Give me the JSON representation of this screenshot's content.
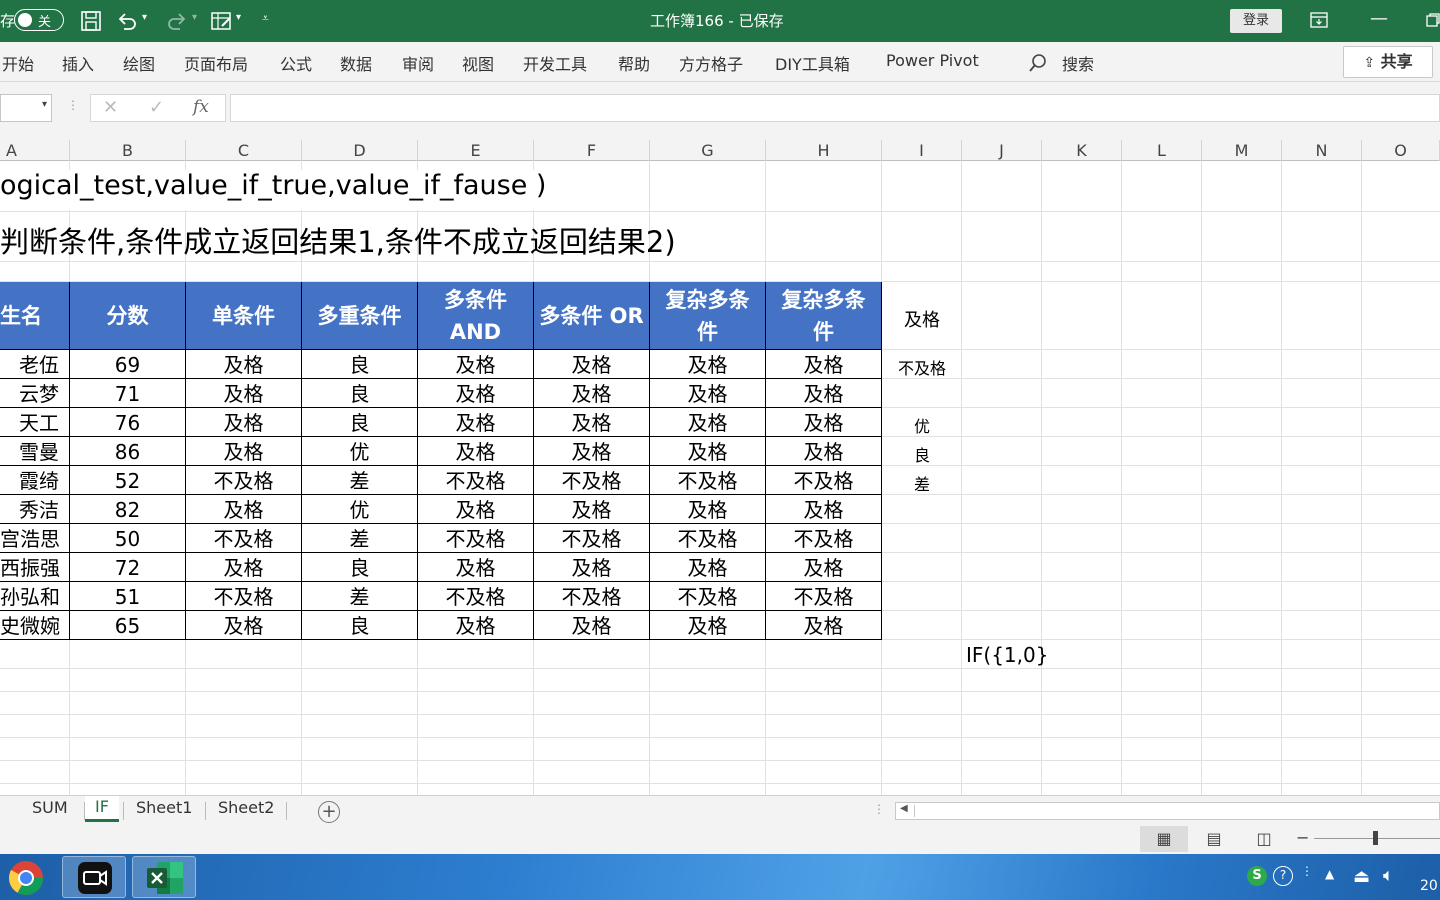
{
  "titlebar": {
    "autosave_prefix": "存",
    "autosave_state": "关",
    "doc_title": "工作簿166 - 已保存",
    "login_label": "登录"
  },
  "ribbon": {
    "tabs": [
      "开始",
      "插入",
      "绘图",
      "页面布局",
      "公式",
      "数据",
      "审阅",
      "视图",
      "开发工具",
      "帮助",
      "方方格子",
      "DIY工具箱",
      "Power Pivot"
    ],
    "search_label": "搜索",
    "share_label": "共享"
  },
  "formula_bar": {
    "name_box": "",
    "formula": "",
    "fx_label": "fx"
  },
  "columns": [
    "A",
    "B",
    "C",
    "D",
    "E",
    "F",
    "G",
    "H",
    "I",
    "J",
    "K",
    "L",
    "M",
    "N",
    "O"
  ],
  "syntax_line1": "ogical_test,value_if_true,value_if_fause )",
  "syntax_line2": "判断条件,条件成立返回结果1,条件不成立返回结果2)",
  "table": {
    "headers": [
      "性名",
      "分数",
      "单条件",
      "多重条件",
      "多条件AND",
      "多条件OR",
      "复杂多条件",
      "复杂多条件"
    ],
    "headers_display": [
      "生名",
      "分数",
      "单条件",
      "多重条件",
      "多条件 AND",
      "多条件 OR",
      "复杂多条 件",
      "复杂多条 件"
    ],
    "rows": [
      [
        "老伍",
        "69",
        "及格",
        "良",
        "及格",
        "及格",
        "及格",
        "及格"
      ],
      [
        "云梦",
        "71",
        "及格",
        "良",
        "及格",
        "及格",
        "及格",
        "及格"
      ],
      [
        "天工",
        "76",
        "及格",
        "良",
        "及格",
        "及格",
        "及格",
        "及格"
      ],
      [
        "雪曼",
        "86",
        "及格",
        "优",
        "及格",
        "及格",
        "及格",
        "及格"
      ],
      [
        "霞绮",
        "52",
        "不及格",
        "差",
        "不及格",
        "不及格",
        "不及格",
        "不及格"
      ],
      [
        "秀洁",
        "82",
        "及格",
        "优",
        "及格",
        "及格",
        "及格",
        "及格"
      ],
      [
        "宫浩思",
        "50",
        "不及格",
        "差",
        "不及格",
        "不及格",
        "不及格",
        "不及格"
      ],
      [
        "西振强",
        "72",
        "及格",
        "良",
        "及格",
        "及格",
        "及格",
        "及格"
      ],
      [
        "孙弘和",
        "51",
        "不及格",
        "差",
        "不及格",
        "不及格",
        "不及格",
        "不及格"
      ],
      [
        "史微婉",
        "65",
        "及格",
        "良",
        "及格",
        "及格",
        "及格",
        "及格"
      ]
    ]
  },
  "side_values": {
    "i_header": "及格",
    "i_row1": "不及格",
    "i_row3": "优",
    "i_row4": "良",
    "i_row5": "差"
  },
  "if_array_text": "IF({1,0}",
  "sheet_tabs": [
    "SUM",
    "IF",
    "Sheet1",
    "Sheet2"
  ],
  "active_sheet": "IF",
  "taskbar": {
    "clock_partial": "20"
  },
  "colors": {
    "excel_green": "#217346",
    "header_blue": "#4472c4"
  }
}
